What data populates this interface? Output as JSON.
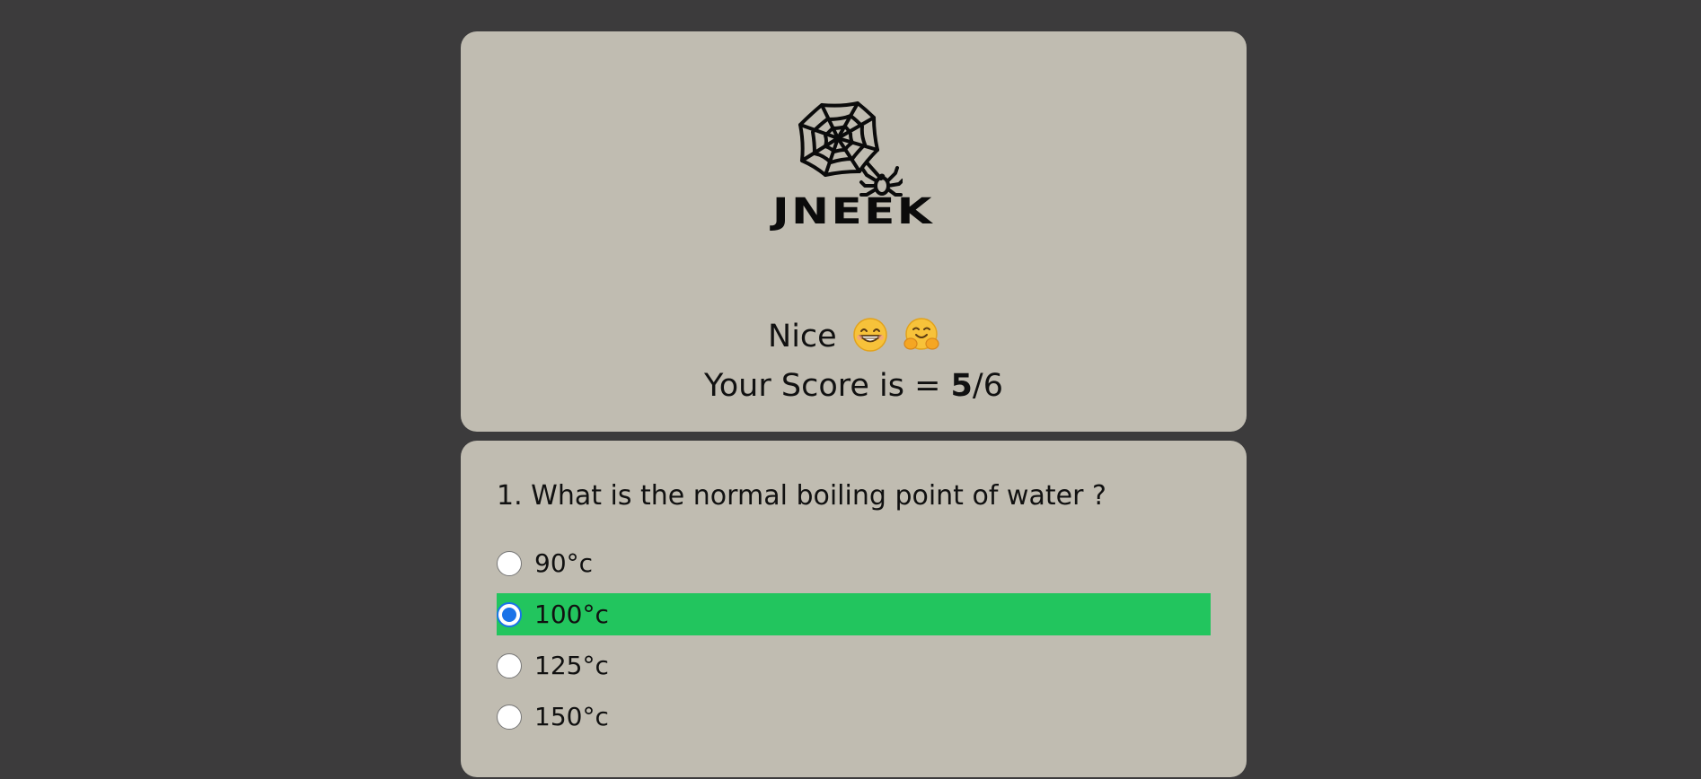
{
  "brand": {
    "name": "JNEEK",
    "logo_icon": "spider-web-icon"
  },
  "result": {
    "message": "Nice",
    "emojis": [
      "grinning-face-icon",
      "hugging-face-icon"
    ],
    "score_prefix": "Your Score is = ",
    "score_value": "5",
    "score_suffix": "/6"
  },
  "quiz": {
    "question": "1. What is the normal boiling point of water ?",
    "options": [
      {
        "label": "90°c",
        "selected": false
      },
      {
        "label": "100°c",
        "selected": true
      },
      {
        "label": "125°c",
        "selected": false
      },
      {
        "label": "150°c",
        "selected": false
      }
    ]
  },
  "colors": {
    "background": "#3c3b3c",
    "card": "#c0bcb1",
    "correct": "#22c55e",
    "radio_accent": "#1a73e8"
  }
}
